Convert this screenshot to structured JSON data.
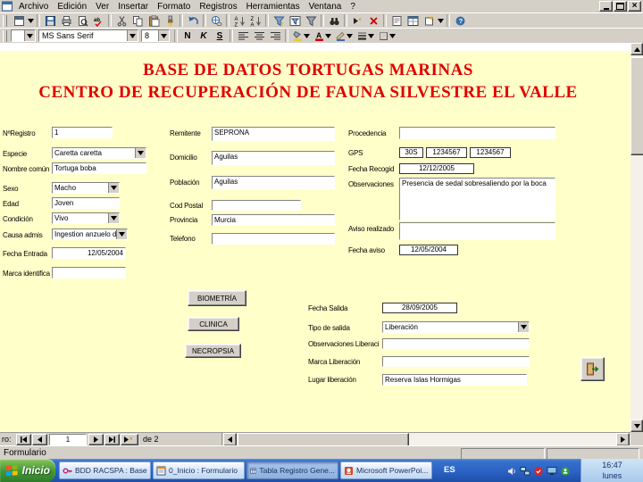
{
  "menubar": {
    "items": [
      "Archivo",
      "Edición",
      "Ver",
      "Insertar",
      "Formato",
      "Registros",
      "Herramientas",
      "Ventana",
      "?"
    ]
  },
  "window_controls": [
    "minimize",
    "restore",
    "close"
  ],
  "toolbar_standard": {
    "buttons": [
      "form-view",
      "view-dropdown",
      "save",
      "print",
      "print-preview",
      "spelling",
      "cut",
      "copy",
      "paste",
      "format-painter",
      "undo",
      "insert-hyperlink",
      "sort-ascending",
      "sort-descending",
      "filter-by-selection",
      "filter-by-form",
      "apply-filter",
      "find",
      "new-record",
      "delete-record",
      "properties",
      "database-window",
      "new-object",
      "new-object-dropdown",
      "help"
    ]
  },
  "toolbar_formatting": {
    "object_selector": "",
    "font_name": "MS Sans Serif",
    "font_size": "8",
    "bold": "N",
    "italic": "K",
    "underline": "S",
    "buttons": [
      "object-selector",
      "font-name",
      "font-size",
      "bold",
      "italic",
      "underline",
      "align-left",
      "align-center",
      "align-right",
      "fill-color",
      "font-color",
      "line-color",
      "line-width",
      "special-effect"
    ]
  },
  "form": {
    "title_line1": "BASE DE DATOS TORTUGAS MARINAS",
    "title_line2": "CENTRO DE RECUPERACIÓN DE FAUNA SILVESTRE EL VALLE",
    "fields": {
      "num_registro": {
        "label": "NºRegistro",
        "value": "1"
      },
      "especie": {
        "label": "Especie",
        "value": "Caretta caretta"
      },
      "nombre_comun": {
        "label": "Nombre común",
        "value": "Tortuga boba"
      },
      "sexo": {
        "label": "Sexo",
        "value": "Macho"
      },
      "edad": {
        "label": "Edad",
        "value": "Joven"
      },
      "condicion": {
        "label": "Condición",
        "value": "Vivo"
      },
      "causa_admision": {
        "label": "Causa admis",
        "value": "Ingestion anzuelo d"
      },
      "fecha_entrada": {
        "label": "Fecha Entrada",
        "value": "12/05/2004"
      },
      "marca_identificativa": {
        "label": "Marca identifica",
        "value": ""
      },
      "remitente": {
        "label": "Remitente",
        "value": "SEPRONA"
      },
      "domicilio": {
        "label": "Domicilio",
        "value": "Aguilas"
      },
      "poblacion": {
        "label": "Población",
        "value": "Aguilas"
      },
      "cod_postal": {
        "label": "Cod Postal",
        "value": ""
      },
      "provincia": {
        "label": "Provincia",
        "value": "Murcia"
      },
      "telefono": {
        "label": "Telefono",
        "value": ""
      },
      "procedencia": {
        "label": "Procedencia",
        "value": ""
      },
      "gps": {
        "label": "GPS",
        "values": [
          "30S",
          "1234567",
          "1234567"
        ]
      },
      "fecha_recogida": {
        "label": "Fecha Recogid",
        "value": "12/12/2005"
      },
      "observaciones": {
        "label": "Observaciones",
        "value": "Presencia de sedal sobresaliendo por la boca"
      },
      "aviso_realizado": {
        "label": "Aviso realizado",
        "value": ""
      },
      "fecha_aviso": {
        "label": "Fecha aviso",
        "value": "12/05/2004"
      },
      "fecha_salida": {
        "label": "Fecha Salida",
        "value": "28/09/2005"
      },
      "tipo_salida": {
        "label": "Tipo de salida",
        "value": "Liberación"
      },
      "observaciones_liberacion": {
        "label": "Observaciones Liberaci",
        "value": ""
      },
      "marca_liberacion": {
        "label": "Marca Liberación",
        "value": ""
      },
      "lugar_liberacion": {
        "label": "Lugar liberación",
        "value": "Reserva Islas Hormigas"
      }
    },
    "buttons": {
      "biometria": "BIOMETRÍA",
      "clinica": "CLINICA",
      "necropsia": "NECROPSIA"
    }
  },
  "navigator": {
    "label": "ro:",
    "current": "1",
    "total": "de 2",
    "buttons": [
      "first-record",
      "previous-record",
      "next-record",
      "last-record",
      "new-record"
    ]
  },
  "statusbar": {
    "text": "Formulario"
  },
  "taskbar": {
    "start": "Inicio",
    "tasks": [
      "BDD RACSPA : Base",
      "0_Inicio : Formulario",
      "Tabla Registro Gene...",
      "Microsoft PowerPoi..."
    ],
    "tray": {
      "language": "ES",
      "icons": [
        "volume",
        "network",
        "antivirus",
        "display",
        "messenger"
      ],
      "time": "16:47",
      "day": "lunes"
    }
  }
}
